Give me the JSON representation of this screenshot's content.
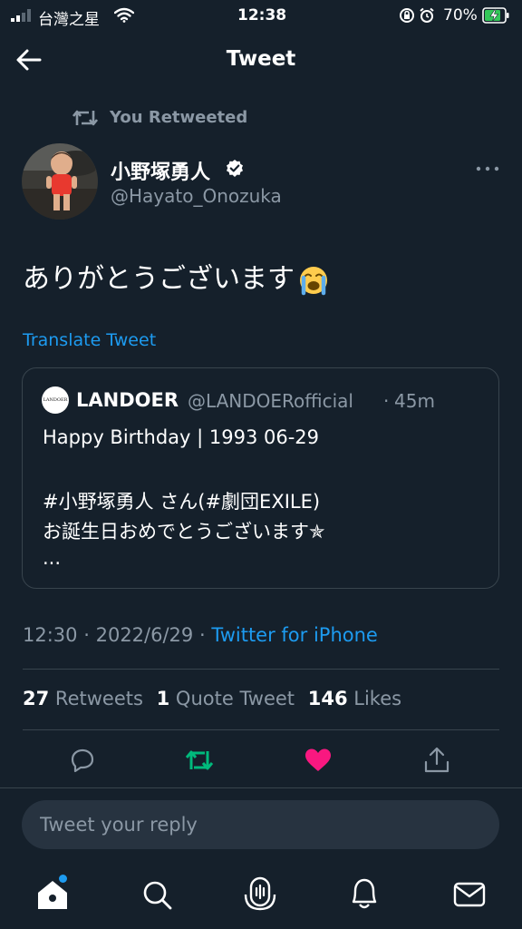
{
  "status_bar": {
    "carrier": "台灣之星",
    "time": "12:38",
    "battery_percent": "70%"
  },
  "header": {
    "title": "Tweet"
  },
  "retweet_indicator": "You Retweeted",
  "author": {
    "name": "小野塚勇人",
    "handle": "@Hayato_Onozuka"
  },
  "tweet": {
    "text": "ありがとうございます",
    "emoji": "loudly-crying-face",
    "translate_label": "Translate Tweet"
  },
  "quoted_tweet": {
    "avatar_text": "LANDOER",
    "name": "LANDOER",
    "handle": "@LANDOERofficial",
    "separator": "·",
    "time": "45m",
    "lines": [
      "Happy Birthday | 1993 06-29",
      "#小野塚勇人 さん(#劇団EXILE)",
      "お誕生日おめでとうございます✯",
      "..."
    ]
  },
  "meta": {
    "time": "12:30",
    "separator": "·",
    "date": "2022/6/29",
    "source": "Twitter for iPhone"
  },
  "stats": {
    "retweets_count": "27",
    "retweets_label": "Retweets",
    "quotes_count": "1",
    "quotes_label": "Quote Tweet",
    "likes_count": "146",
    "likes_label": "Likes"
  },
  "actions": {
    "retweeted": true,
    "liked": true
  },
  "reply": {
    "placeholder": "Tweet your reply"
  },
  "colors": {
    "background": "#15202b",
    "accent": "#1d9bf0",
    "retweet_green": "#00ba7c",
    "like_pink": "#f91880",
    "secondary_text": "#8b98a5"
  },
  "tab_bar": {
    "icons": [
      "home-icon",
      "search-icon",
      "spaces-icon",
      "notifications-icon",
      "messages-icon"
    ],
    "home_has_badge": true
  }
}
